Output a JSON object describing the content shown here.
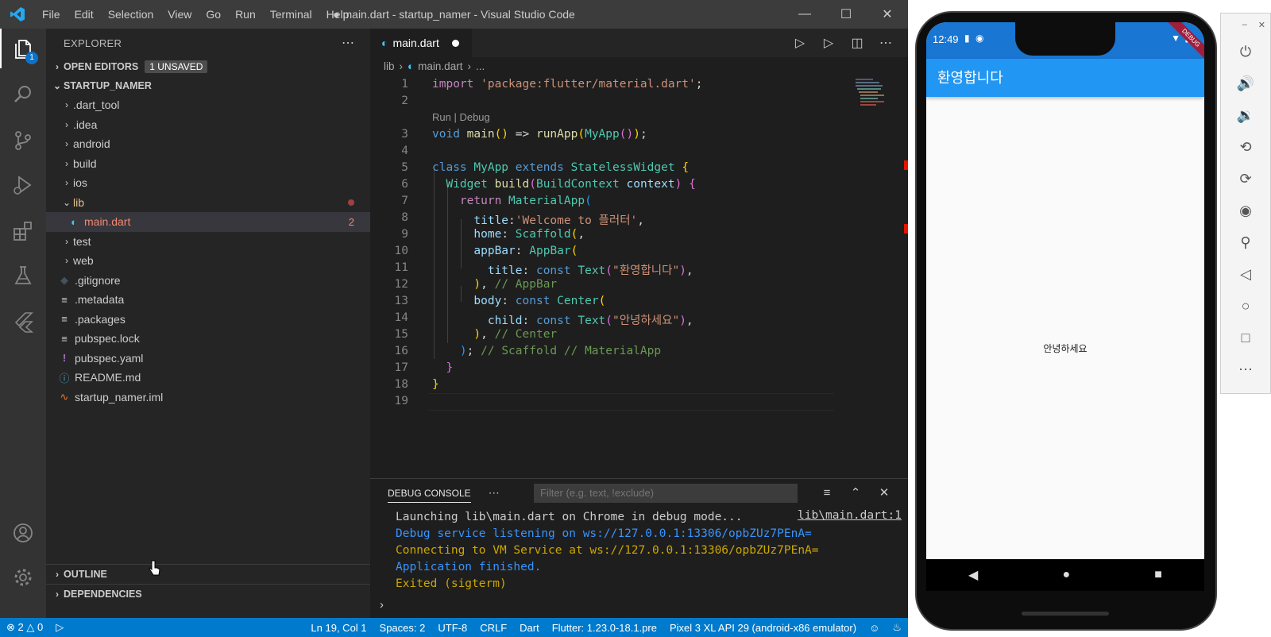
{
  "window": {
    "title": "● main.dart - startup_namer - Visual Studio Code",
    "menu": [
      "File",
      "Edit",
      "Selection",
      "View",
      "Go",
      "Run",
      "Terminal",
      "Help"
    ]
  },
  "activity": {
    "explorer_badge": "1"
  },
  "sidebar": {
    "title": "EXPLORER",
    "open_editors_label": "OPEN EDITORS",
    "unsaved_badge": "1 UNSAVED",
    "project_label": "STARTUP_NAMER",
    "tree": [
      {
        "name": ".dart_tool",
        "kind": "folder"
      },
      {
        "name": ".idea",
        "kind": "folder"
      },
      {
        "name": "android",
        "kind": "folder"
      },
      {
        "name": "build",
        "kind": "folder"
      },
      {
        "name": "ios",
        "kind": "folder"
      },
      {
        "name": "lib",
        "kind": "folder-open"
      },
      {
        "name": "main.dart",
        "kind": "dart",
        "errors": "2"
      },
      {
        "name": "test",
        "kind": "folder"
      },
      {
        "name": "web",
        "kind": "folder"
      },
      {
        "name": ".gitignore",
        "kind": "git"
      },
      {
        "name": ".metadata",
        "kind": "lines"
      },
      {
        "name": ".packages",
        "kind": "lines"
      },
      {
        "name": "pubspec.lock",
        "kind": "lines"
      },
      {
        "name": "pubspec.yaml",
        "kind": "yaml"
      },
      {
        "name": "README.md",
        "kind": "info"
      },
      {
        "name": "startup_namer.iml",
        "kind": "rss"
      }
    ],
    "outline_label": "OUTLINE",
    "dependencies_label": "DEPENDENCIES"
  },
  "editor": {
    "tab_label": "main.dart",
    "breadcrumb_root": "lib",
    "breadcrumb_file": "main.dart",
    "breadcrumb_more": "...",
    "codelens": "Run | Debug",
    "line_numbers": [
      "1",
      "2",
      "3",
      "4",
      "5",
      "6",
      "7",
      "8",
      "9",
      "10",
      "11",
      "12",
      "13",
      "14",
      "15",
      "16",
      "17",
      "18",
      "19"
    ]
  },
  "panel": {
    "tab_label": "DEBUG CONSOLE",
    "filter_placeholder": "Filter (e.g. text, !exclude)",
    "lines": [
      {
        "text": "Launching lib\\main.dart on Chrome in debug mode...",
        "color": "#cccccc"
      },
      {
        "text": "Debug service listening on ws://127.0.0.1:13306/opbZUz7PEnA=",
        "color": "#3794ff"
      },
      {
        "text": "Connecting to VM Service at ws://127.0.0.1:13306/opbZUz7PEnA=",
        "color": "#cca700"
      },
      {
        "text": "Application finished.",
        "color": "#3794ff"
      },
      {
        "text": "Exited (sigterm)",
        "color": "#cca700"
      }
    ],
    "source_link": "lib\\main.dart:1",
    "prompt": "›"
  },
  "statusbar": {
    "errors": "2",
    "warnings": "0",
    "position": "Ln 19, Col 1",
    "spaces": "Spaces: 2",
    "encoding": "UTF-8",
    "eol": "CRLF",
    "language": "Dart",
    "flutter": "Flutter: 1.23.0-18.1.pre",
    "device": "Pixel 3 XL API 29 (android-x86 emulator)"
  },
  "phone": {
    "time": "12:49",
    "appbar_title": "환영합니다",
    "body_text": "안녕하세요",
    "ribbon": "DEBUG"
  },
  "colors": {
    "accent": "#007acc",
    "appbar": "#2196f3",
    "statusbar_phone": "#1976d2"
  }
}
